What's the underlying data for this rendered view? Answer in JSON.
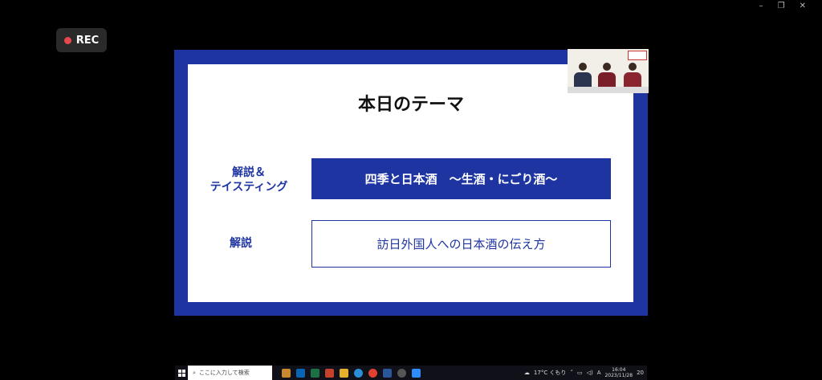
{
  "recording": {
    "label": "REC"
  },
  "window_controls": {
    "minimize": "–",
    "restore": "❐",
    "close": "✕"
  },
  "slide": {
    "title": "本日のテーマ",
    "row1": {
      "label_line1": "解説＆",
      "label_line2": "テイスティング",
      "content": "四季と日本酒　～生酒・にごり酒～"
    },
    "row2": {
      "label": "解説",
      "content": "訪日外国人への日本酒の伝え方"
    }
  },
  "taskbar": {
    "search_placeholder": "ここに入力して検索",
    "weather": "17°C くもり",
    "ime": "A",
    "time": "16:04",
    "date": "2023/11/28",
    "notification_count": "20"
  }
}
